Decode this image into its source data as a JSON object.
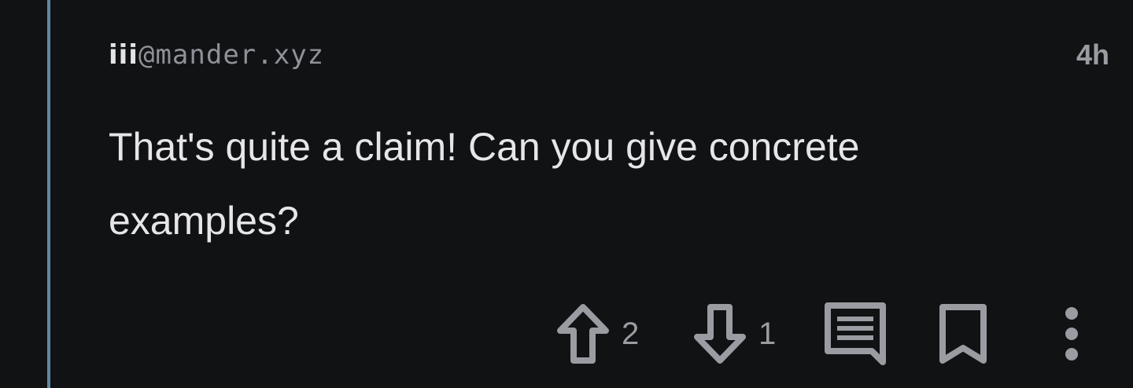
{
  "comment": {
    "author_user": "iii",
    "author_instance": "@mander.xyz",
    "time_ago": "4h",
    "text": "That's quite a claim! Can you give concrete examples?",
    "upvotes": "2",
    "downvotes": "1"
  },
  "icons": {
    "upvote": "arrow-up-icon",
    "downvote": "arrow-down-icon",
    "reply": "message-icon",
    "save": "bookmark-icon",
    "more": "more-vertical-icon"
  },
  "colors": {
    "background": "#111214",
    "thread_line": "#5f8aa0",
    "text": "#e6e6ea",
    "muted": "#9a9ca2"
  }
}
